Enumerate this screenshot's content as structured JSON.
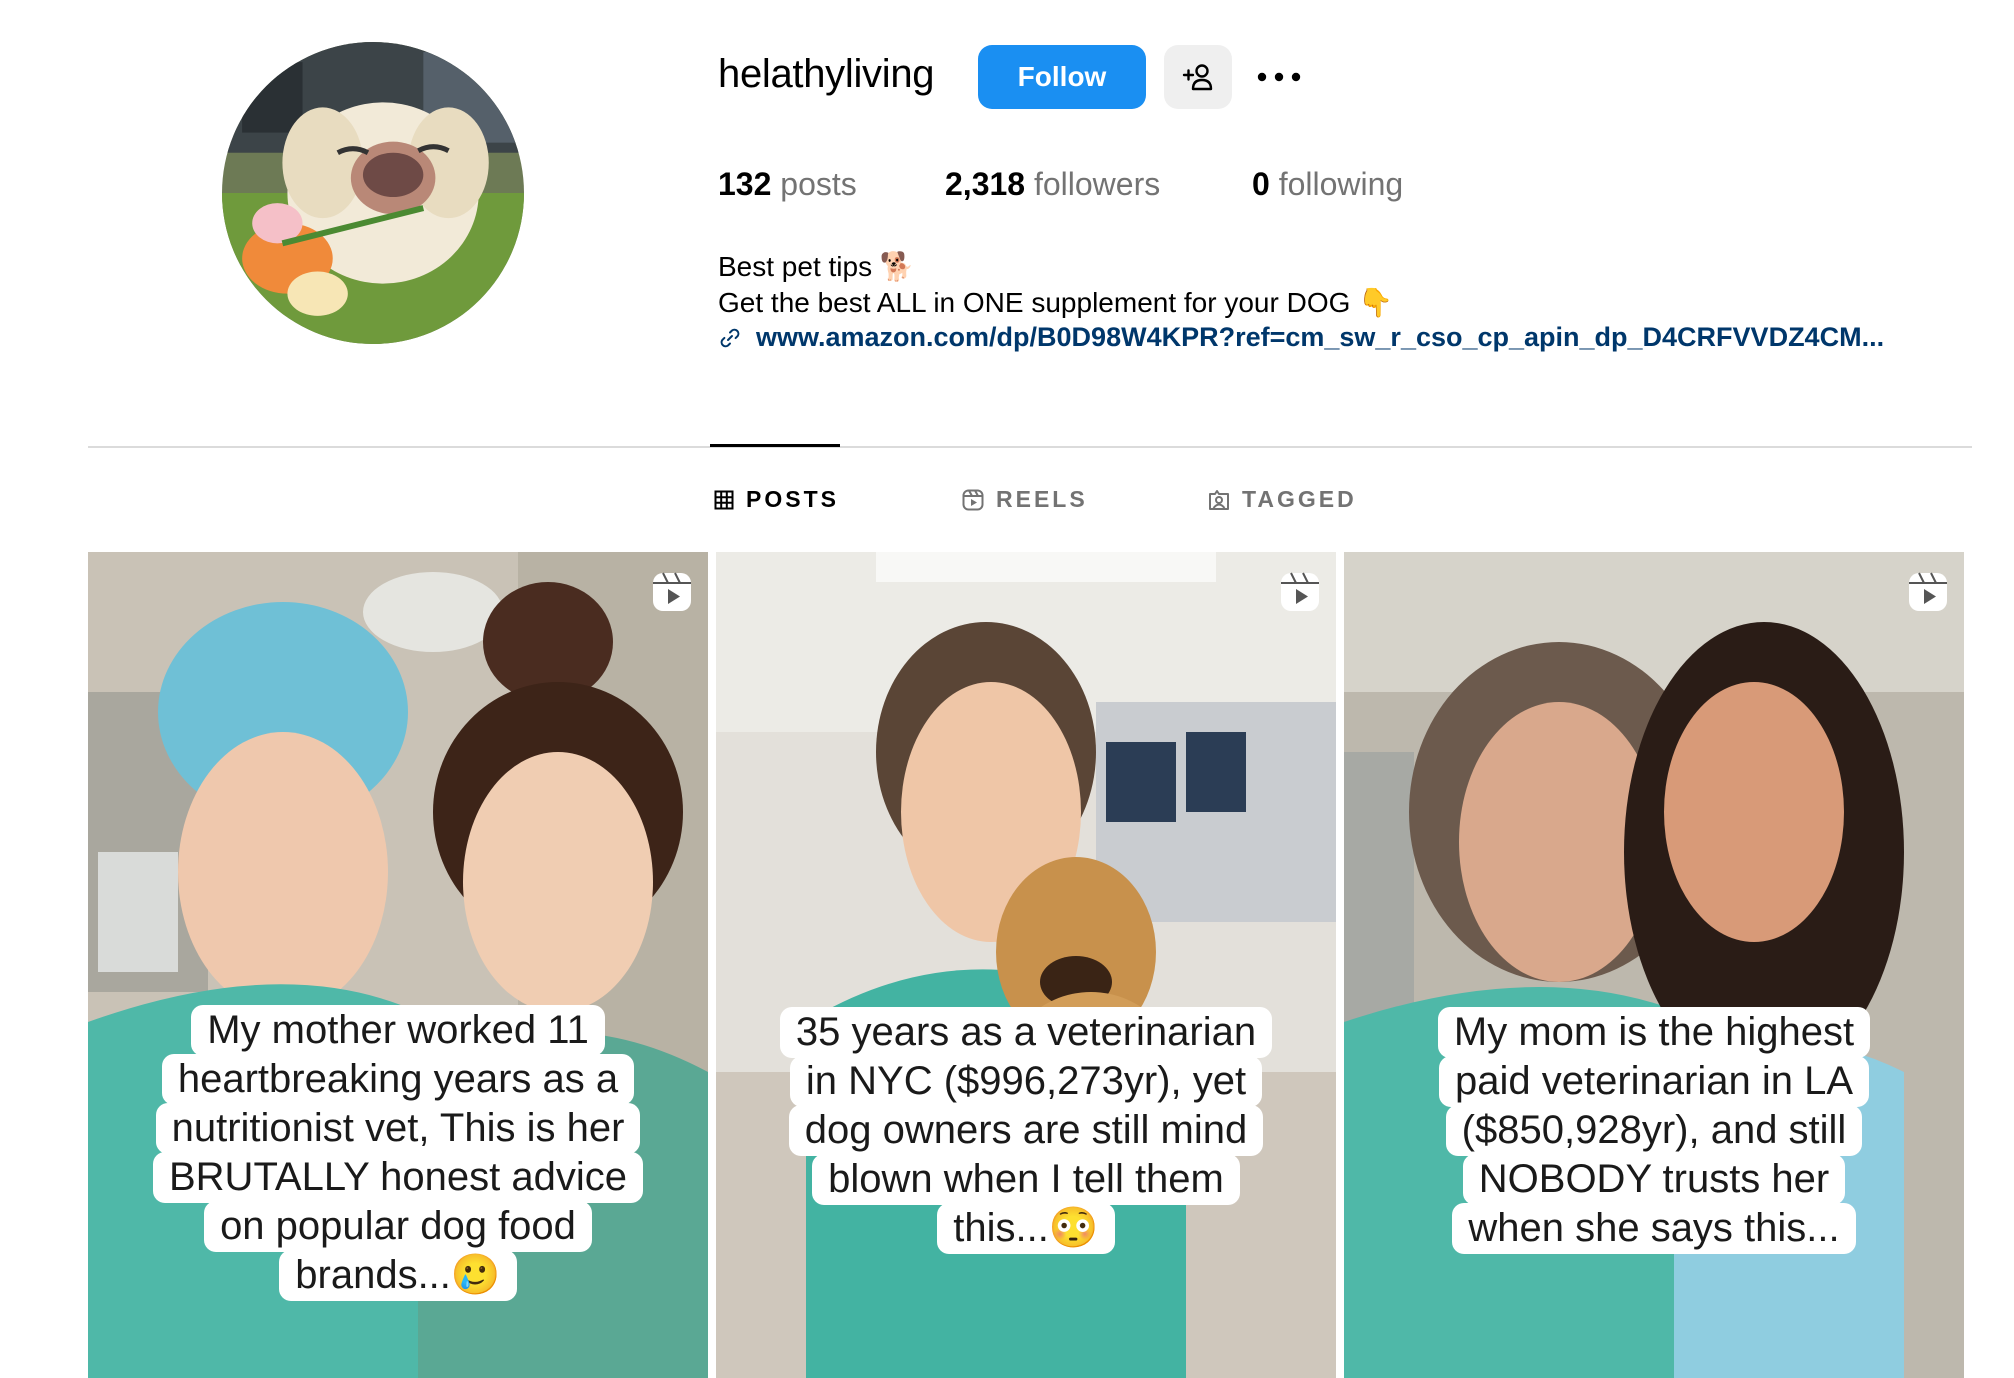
{
  "profile": {
    "username": "helathyliving",
    "follow_label": "Follow",
    "stats": {
      "posts_count": "132",
      "posts_label": "posts",
      "followers_count": "2,318",
      "followers_label": "followers",
      "following_count": "0",
      "following_label": "following"
    },
    "bio_line1": "Best pet tips 🐕",
    "bio_line2": "Get the best ALL in ONE supplement for your DOG 👇",
    "link": "www.amazon.com/dp/B0D98W4KPR?ref=cm_sw_r_cso_cp_apin_dp_D4CRFVVDZ4CM..."
  },
  "tabs": [
    {
      "label": "POSTS",
      "active": true
    },
    {
      "label": "REELS",
      "active": false
    },
    {
      "label": "TAGGED",
      "active": false
    }
  ],
  "posts": [
    {
      "caption_lines": [
        "My mother worked 11",
        "heartbreaking years as a",
        "nutritionist vet, This is her",
        "BRUTALLY honest advice",
        "on popular dog food",
        "brands...🥲"
      ]
    },
    {
      "caption_lines": [
        "35 years as a veterinarian",
        "in NYC ($996,273yr), yet",
        "dog owners are still mind",
        "blown when I tell them",
        "this...😳"
      ]
    },
    {
      "caption_lines": [
        "My mom is the highest",
        "paid veterinarian in LA",
        "($850,928yr), and still",
        "NOBODY trusts her",
        "when she says this..."
      ]
    }
  ],
  "colors": {
    "follow_button": "#1a8ff2",
    "link": "#00376b",
    "muted_text": "#737373",
    "scrubs": "#4fb8a8"
  },
  "icons": [
    "suggest-person-icon",
    "more-options-icon",
    "link-icon",
    "grid-icon",
    "reels-icon",
    "tagged-icon",
    "reel-badge-icon"
  ]
}
